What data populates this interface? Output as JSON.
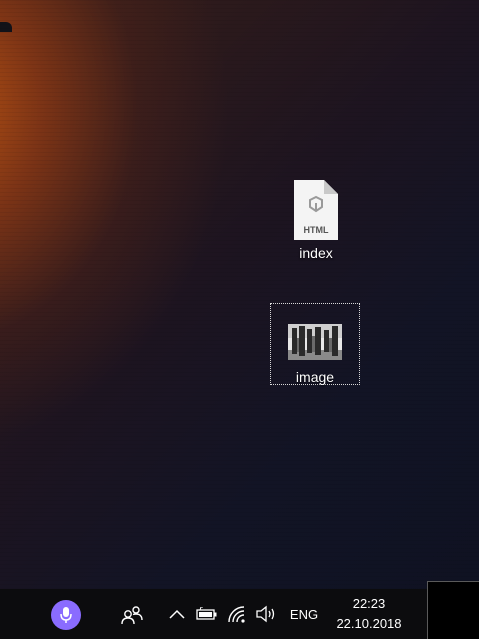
{
  "desktop": {
    "icons": [
      {
        "label": "index",
        "badge": "HTML",
        "type": "html-file-icon"
      },
      {
        "label": "image",
        "type": "image-thumbnail-icon",
        "selected": true
      }
    ]
  },
  "taskbar": {
    "cortana_icon": "microphone-icon",
    "cortana_color": "#8a6cff",
    "people_icon": "people-icon",
    "tray_chevron_icon": "chevron-up-icon",
    "battery_icon": "battery-icon",
    "wifi_icon": "wifi-icon",
    "volume_icon": "volume-icon",
    "language": "ENG",
    "time": "22:23",
    "date": "22.10.2018"
  }
}
